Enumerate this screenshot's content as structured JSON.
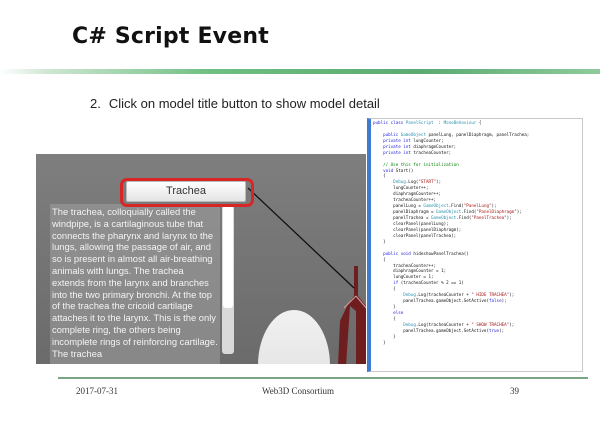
{
  "slide": {
    "title": "C# Script Event",
    "bullet_number": "2.",
    "bullet_text": "Click on model title button to show model detail"
  },
  "scene": {
    "button_label": "Trachea",
    "panel_text": "The trachea, colloquially called the windpipe, is a cartilaginous tube that connects the pharynx and larynx to the lungs, allowing the passage of air, and so is present in almost all air-breathing animals with lungs. The trachea extends from the larynx and branches into the two primary bronchi. At the top of the trachea the cricoid cartilage attaches it to the larynx. This is the only complete ring, the others being incomplete rings of reinforcing cartilage. The trachea",
    "highlight_color": "#d82626"
  },
  "code_lines": [
    [
      [
        "kw",
        "public class "
      ],
      [
        "ty",
        "PanelScript"
      ],
      [
        "",
        "  : "
      ],
      [
        "ty",
        "MonoBehaviour"
      ],
      [
        "",
        " {"
      ]
    ],
    [],
    [
      [
        "",
        "    "
      ],
      [
        "kw",
        "public "
      ],
      [
        "ty",
        "GameObject"
      ],
      [
        "",
        " panelLung, panelDiaphragm, panelTrachea;"
      ]
    ],
    [
      [
        "",
        "    "
      ],
      [
        "kw",
        "private int"
      ],
      [
        "",
        " lungCounter;"
      ]
    ],
    [
      [
        "",
        "    "
      ],
      [
        "kw",
        "private int"
      ],
      [
        "",
        " diaphragmCounter;"
      ]
    ],
    [
      [
        "",
        "    "
      ],
      [
        "kw",
        "private int"
      ],
      [
        "",
        " tracheaCounter;"
      ]
    ],
    [],
    [
      [
        "cm",
        "    // Use this for initialization"
      ]
    ],
    [
      [
        "",
        "    "
      ],
      [
        "kw",
        "void"
      ],
      [
        "",
        " Start()"
      ]
    ],
    [
      [
        "",
        "    {"
      ]
    ],
    [
      [
        "",
        "        "
      ],
      [
        "ty",
        "Debug"
      ],
      [
        "",
        ".Log("
      ],
      [
        "st",
        "\"START\""
      ],
      [
        "",
        ");"
      ]
    ],
    [
      [
        "",
        "        lungCounter++;"
      ]
    ],
    [
      [
        "",
        "        diaphragmCounter++;"
      ]
    ],
    [
      [
        "",
        "        tracheaCounter++;"
      ]
    ],
    [
      [
        "",
        "        panelLung = "
      ],
      [
        "ty",
        "GameObject"
      ],
      [
        "",
        ".Find("
      ],
      [
        "st",
        "\"PanelLung\""
      ],
      [
        "",
        ");"
      ]
    ],
    [
      [
        "",
        "        panelDiaphragm = "
      ],
      [
        "ty",
        "GameObject"
      ],
      [
        "",
        ".Find("
      ],
      [
        "st",
        "\"PanelDiaphragm\""
      ],
      [
        "",
        ");"
      ]
    ],
    [
      [
        "",
        "        panelTrachea = "
      ],
      [
        "ty",
        "GameObject"
      ],
      [
        "",
        ".Find("
      ],
      [
        "st",
        "\"PanelTrachea\""
      ],
      [
        "",
        ");"
      ]
    ],
    [
      [
        "",
        "        clearPanel(panelLung);"
      ]
    ],
    [
      [
        "",
        "        clearPanel(panelDiaphragm);"
      ]
    ],
    [
      [
        "",
        "        clearPanel(panelTrachea);"
      ]
    ],
    [
      [
        "",
        "    }"
      ]
    ],
    [],
    [
      [
        "",
        "    "
      ],
      [
        "kw",
        "public void"
      ],
      [
        "",
        " hideshowPanelTrachea()"
      ]
    ],
    [
      [
        "",
        "    {"
      ]
    ],
    [
      [
        "",
        "        tracheaCounter++;"
      ]
    ],
    [
      [
        "",
        "        diaphragmCounter = 1;"
      ]
    ],
    [
      [
        "",
        "        lungCounter = 1;"
      ]
    ],
    [
      [
        "",
        "        "
      ],
      [
        "kw",
        "if"
      ],
      [
        "",
        " (tracheaCounter % 2 == 1)"
      ]
    ],
    [
      [
        "",
        "        {"
      ]
    ],
    [
      [
        "",
        "            "
      ],
      [
        "ty",
        "Debug"
      ],
      [
        "",
        ".Log(tracheaCounter + "
      ],
      [
        "st",
        "\" HIDE TRACHEA\""
      ],
      [
        "",
        ");"
      ]
    ],
    [
      [
        "",
        "            panelTrachea.gameObject.SetActive("
      ],
      [
        "kw",
        "false"
      ],
      [
        "",
        ");"
      ]
    ],
    [
      [
        "",
        "        }"
      ]
    ],
    [
      [
        "",
        "        "
      ],
      [
        "kw",
        "else"
      ]
    ],
    [
      [
        "",
        "        {"
      ]
    ],
    [
      [
        "",
        "            "
      ],
      [
        "ty",
        "Debug"
      ],
      [
        "",
        ".Log(tracheaCounter + "
      ],
      [
        "st",
        "\" SHOW TRACHEA\""
      ],
      [
        "",
        ");"
      ]
    ],
    [
      [
        "",
        "            panelTrachea.gameObject.SetActive("
      ],
      [
        "kw",
        "true"
      ],
      [
        "",
        ");"
      ]
    ],
    [
      [
        "",
        "        }"
      ]
    ],
    [
      [
        "",
        "    }"
      ]
    ]
  ],
  "footer": {
    "date": "2017-07-31",
    "org": "Web3D Consortium",
    "page": "39"
  }
}
